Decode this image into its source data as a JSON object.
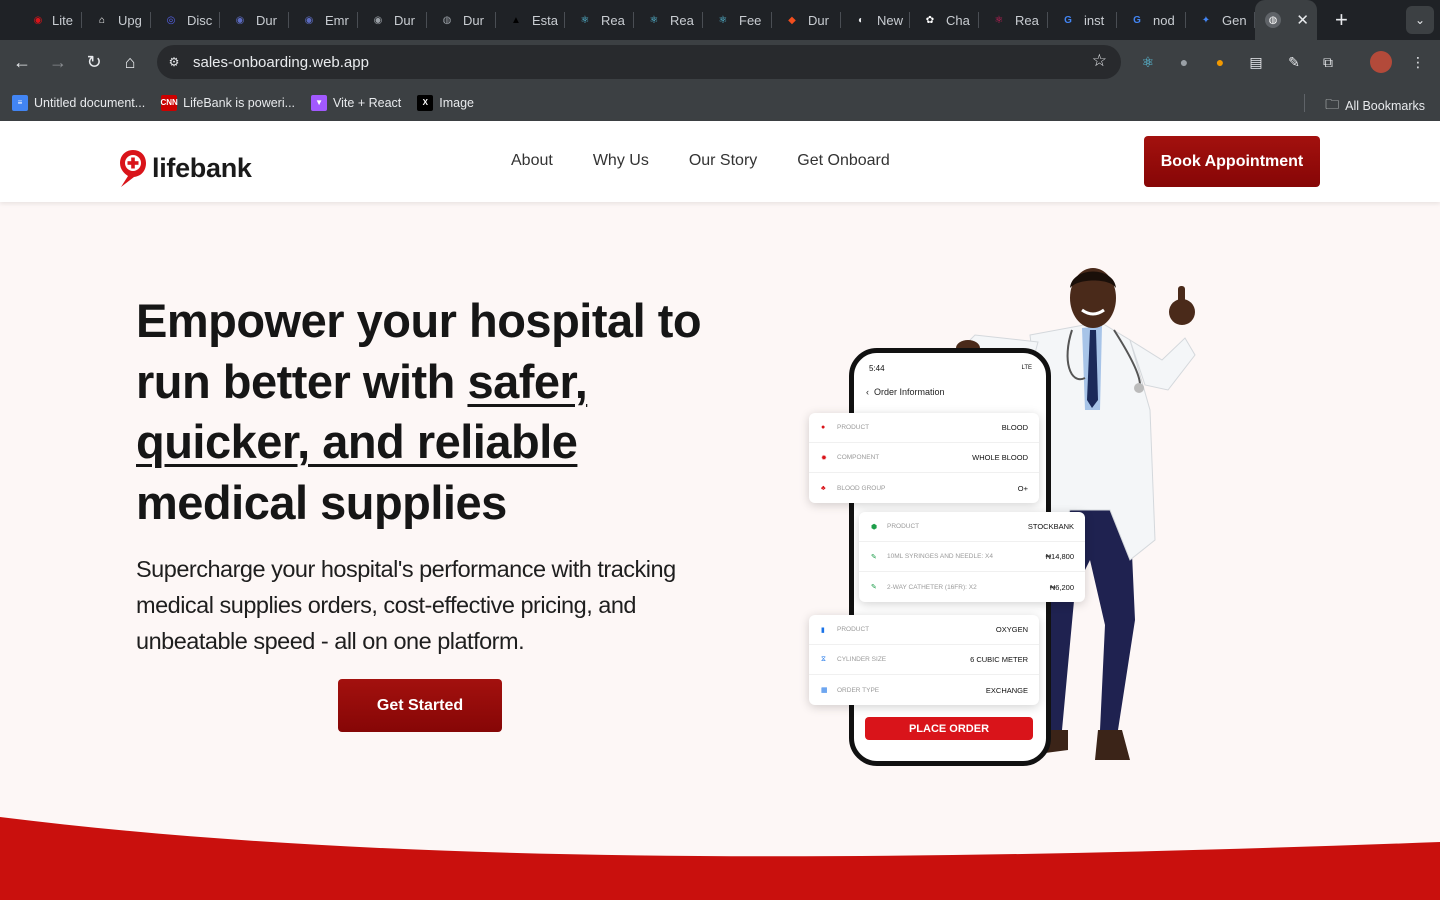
{
  "browser": {
    "tabs": [
      {
        "label": "Lite",
        "icon": "lifebank-icon",
        "color": "#d9141a"
      },
      {
        "label": "Upg",
        "icon": "upgrade-icon",
        "color": "#ffffff"
      },
      {
        "label": "Disc",
        "icon": "discord-icon",
        "color": "#5865f2"
      },
      {
        "label": "Dur",
        "icon": "dur-icon",
        "color": "#5c6bc0"
      },
      {
        "label": "Emr",
        "icon": "emr-icon",
        "color": "#5c6bc0"
      },
      {
        "label": "Dur",
        "icon": "dur-icon",
        "color": "#9aa0a6"
      },
      {
        "label": "Dur",
        "icon": "globe-icon",
        "color": "#9aa0a6"
      },
      {
        "label": "Esta",
        "icon": "vercel-icon",
        "color": "#000000"
      },
      {
        "label": "Rea",
        "icon": "react-icon",
        "color": "#61dafb"
      },
      {
        "label": "Rea",
        "icon": "react-icon",
        "color": "#61dafb"
      },
      {
        "label": "Fee",
        "icon": "react-icon",
        "color": "#61dafb"
      },
      {
        "label": "Dur",
        "icon": "figma-icon",
        "color": "#f24e1e"
      },
      {
        "label": "New",
        "icon": "chrome-icon",
        "color": "#e8eaed"
      },
      {
        "label": "Cha",
        "icon": "chatgpt-icon",
        "color": "#ffffff"
      },
      {
        "label": "Rea",
        "icon": "react-icon",
        "color": "#e91e63"
      },
      {
        "label": "inst",
        "icon": "google-icon",
        "color": "#4285f4"
      },
      {
        "label": "nod",
        "icon": "google-icon",
        "color": "#4285f4"
      },
      {
        "label": "Gen",
        "icon": "gemini-icon",
        "color": "#4285f4"
      }
    ],
    "active_tab_icon": "globe-icon",
    "close_glyph": "✕",
    "new_tab_glyph": "+",
    "url": "sales-onboarding.web.app",
    "bookmarks": [
      {
        "label": "Untitled document...",
        "icon": "docs-icon",
        "color": "#4285f4"
      },
      {
        "label": "LifeBank is poweri...",
        "icon": "cnn-icon",
        "color": "#cc0000"
      },
      {
        "label": "Vite + React",
        "icon": "vite-icon",
        "color": "#a259ff"
      },
      {
        "label": "Image",
        "icon": "x-icon",
        "color": "#000000"
      }
    ],
    "all_bookmarks": "All Bookmarks"
  },
  "site": {
    "logo_text": "lifebank",
    "nav": [
      "About",
      "Why Us",
      "Our Story",
      "Get Onboard"
    ],
    "book_button": "Book Appointment",
    "brand_color": "#9b0c0c"
  },
  "hero": {
    "title_plain_1": "Empower your hospital to run better with ",
    "title_underline": "safer, quicker, and reliable",
    "title_plain_2": " medical supplies",
    "subtitle": "Supercharge your hospital's performance with tracking medical supplies orders, cost-effective pricing, and unbeatable speed - all on one platform.",
    "cta": "Get Started"
  },
  "phone": {
    "time": "5:44",
    "signal": "LTE",
    "header": "Order Information",
    "blood_card": [
      {
        "key": "PRODUCT",
        "value": "BLOOD",
        "icon": "drop-icon"
      },
      {
        "key": "COMPONENT",
        "value": "WHOLE BLOOD",
        "icon": "gear-icon"
      },
      {
        "key": "BLOOD GROUP",
        "value": "O+",
        "icon": "people-icon"
      }
    ],
    "stock_card": [
      {
        "key": "PRODUCT",
        "value": "STOCKBANK",
        "icon": "box-icon"
      },
      {
        "key": "10ML SYRINGES AND NEEDLE: X4",
        "value": "₦14,800",
        "icon": "syringe-icon"
      },
      {
        "key": "2-WAY CATHETER (16FR): X2",
        "value": "₦6,200",
        "icon": "syringe-icon"
      }
    ],
    "oxygen_card": [
      {
        "key": "PRODUCT",
        "value": "OXYGEN",
        "icon": "cylinder-icon"
      },
      {
        "key": "CYLINDER SIZE",
        "value": "6 CUBIC METER",
        "icon": "size-icon"
      },
      {
        "key": "ORDER TYPE",
        "value": "EXCHANGE",
        "icon": "grid-icon"
      }
    ],
    "place_order": "PLACE ORDER"
  }
}
